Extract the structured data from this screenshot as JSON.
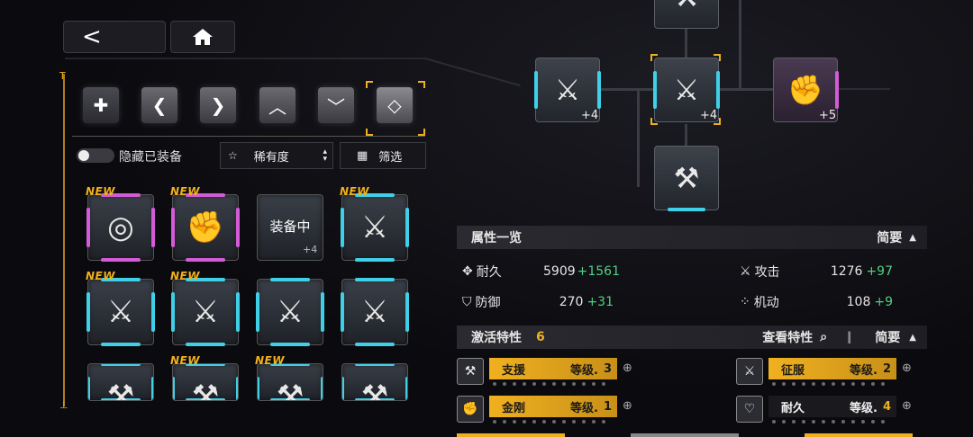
{
  "topbar": {
    "back_icon": "back-arrow-icon",
    "home_icon": "home-icon"
  },
  "filters": {
    "hide_equipped_label": "隐藏已装备",
    "sort_label": "稀有度",
    "filter_label": "筛选"
  },
  "side_ruler": {
    "top": "T",
    "bottom": "⊥"
  },
  "cards": [
    {
      "new": "NEW",
      "icon": "target-icon",
      "color": "#d35bd8",
      "badge": "",
      "level": ""
    },
    {
      "new": "NEW",
      "icon": "fist-icon",
      "color": "#d35bd8",
      "badge": "",
      "level": ""
    },
    {
      "new": "",
      "icon": "equipped-card",
      "color": "#4a4f58",
      "badge": "装备中",
      "level": "+4"
    },
    {
      "new": "NEW",
      "icon": "sword-icon",
      "color": "#3fd0e8",
      "badge": "",
      "level": ""
    },
    {
      "new": "NEW",
      "icon": "sword-icon",
      "color": "#3fd0e8",
      "badge": "",
      "level": ""
    },
    {
      "new": "NEW",
      "icon": "sword-icon",
      "color": "#3fd0e8",
      "badge": "",
      "level": ""
    },
    {
      "new": "",
      "icon": "sword-icon",
      "color": "#3fd0e8",
      "badge": "",
      "level": ""
    },
    {
      "new": "",
      "icon": "sword-icon",
      "color": "#3fd0e8",
      "badge": "",
      "level": ""
    },
    {
      "new": "",
      "icon": "wrench-icon",
      "color": "#3fd0e8",
      "badge": "",
      "level": ""
    },
    {
      "new": "NEW",
      "icon": "wrench-icon",
      "color": "#3fd0e8",
      "badge": "",
      "level": ""
    },
    {
      "new": "NEW",
      "icon": "wrench-icon",
      "color": "#3fd0e8",
      "badge": "",
      "level": ""
    },
    {
      "new": "",
      "icon": "wrench-icon",
      "color": "#3fd0e8",
      "badge": "",
      "level": ""
    }
  ],
  "tree": {
    "left_level": "+4",
    "center_level": "+4",
    "right_level": "+5"
  },
  "attributes": {
    "title": "属性一览",
    "mode": "简要",
    "durability_label": "耐久",
    "durability_value": "5909",
    "durability_bonus": "+1561",
    "attack_label": "攻击",
    "attack_value": "1276",
    "attack_bonus": "+97",
    "defense_label": "防御",
    "defense_value": "270",
    "defense_bonus": "+31",
    "mobility_label": "机动",
    "mobility_value": "108",
    "mobility_bonus": "+9"
  },
  "traits": {
    "title": "激活特性",
    "count": "6",
    "view_label": "查看特性",
    "mode": "简要",
    "items": [
      {
        "name": "支援",
        "level_label": "等级.",
        "level": "3",
        "highlight": true
      },
      {
        "name": "征服",
        "level_label": "等级.",
        "level": "2",
        "highlight": true
      },
      {
        "name": "金刚",
        "level_label": "等级.",
        "level": "1",
        "highlight": true
      },
      {
        "name": "耐久",
        "level_label": "等级.",
        "level": "4",
        "highlight": false
      }
    ]
  },
  "colors": {
    "accent": "#f0b020",
    "cyan": "#3fd0e8",
    "magenta": "#d35bd8",
    "bonus": "#4ed281"
  }
}
